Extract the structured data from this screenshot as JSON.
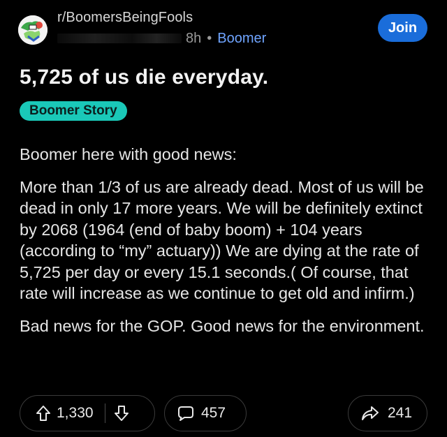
{
  "post": {
    "subreddit": "r/BoomersBeingFools",
    "time": "8h",
    "separator": "•",
    "user": "Boomer",
    "join_label": "Join",
    "title": "5,725 of us die everyday.",
    "flair": "Boomer Story",
    "body": [
      "Boomer here with good news:",
      "More than 1/3 of us are already dead. Most of us will be dead in only 17 more years. We will be definitely extinct by 2068 (1964 (end of baby boom) + 104 years (according to “my” actuary)) We are dying at the rate of 5,725 per day or every 15.1 seconds.( Of course, that rate will increase as we continue to get old and infirm.)",
      "Bad news for the GOP. Good news for the environment."
    ]
  },
  "actions": {
    "votes": "1,330",
    "comments": "457",
    "shares": "241"
  },
  "colors": {
    "background": "#000000",
    "join_button": "#1a6dda",
    "flair_bg": "#1ac8b8",
    "user_link": "#6fa4ff"
  },
  "icons": {
    "avatar": "subreddit-avatar",
    "upvote": "upvote-arrow-icon",
    "downvote": "downvote-arrow-icon",
    "comment": "comment-bubble-icon",
    "share": "share-arrow-icon"
  }
}
